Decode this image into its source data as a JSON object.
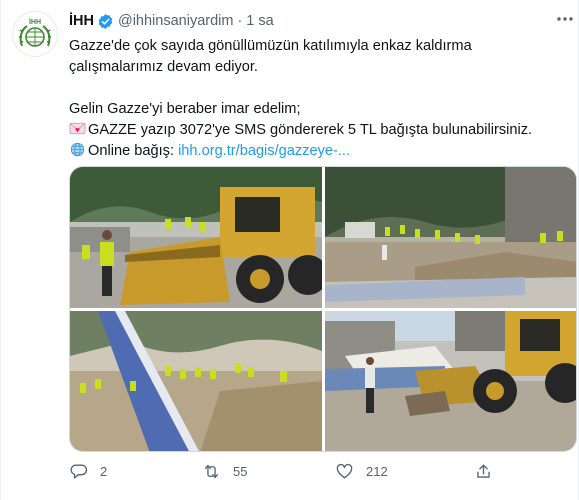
{
  "author": {
    "name": "İHH",
    "handle": "@ihhinsaniyardim",
    "separator": "·",
    "time": "1 sa",
    "avatar_label": "İHH"
  },
  "tweet": {
    "line1": "Gazze'de çok sayıda gönüllümüzün katılımıyla enkaz kaldırma çalışmalarımız devam ediyor.",
    "line2": "Gelin Gazze'yi beraber imar edelim;",
    "line3": "GAZZE yazıp 3072'ye SMS göndererek 5 TL bağışta bulunabilirsiniz.",
    "line4_prefix": "Online bağış:",
    "line4_link": "ihh.org.tr/bagis/gazzeye-..."
  },
  "actions": {
    "reply_count": "2",
    "retweet_count": "55",
    "like_count": "212"
  },
  "colors": {
    "accent": "#1d9bf0",
    "muted": "#536471",
    "text": "#0f1419",
    "logo_green": "#3c8a2e"
  },
  "icons": [
    "ihh-logo-icon",
    "verified-badge-icon",
    "more-options-icon",
    "love-letter-icon",
    "globe-icon",
    "reply-icon",
    "retweet-icon",
    "like-icon",
    "share-icon"
  ]
}
